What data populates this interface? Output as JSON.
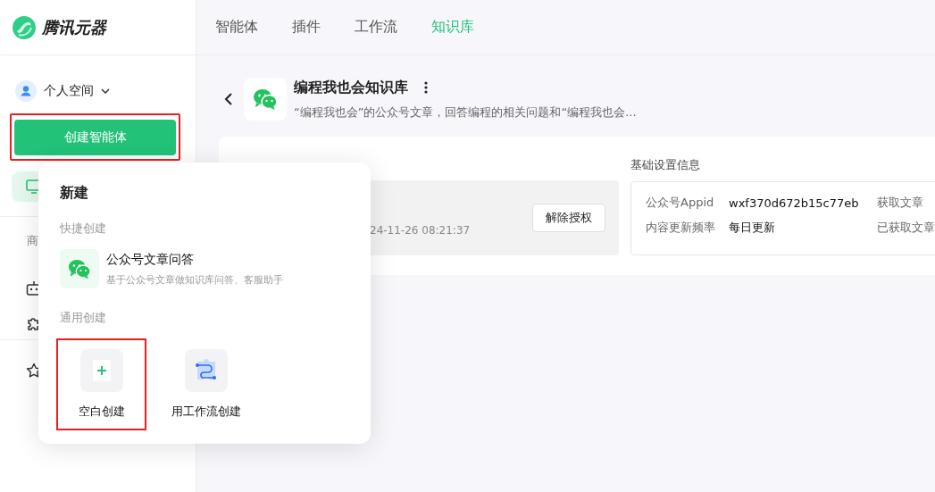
{
  "sidebar": {
    "logo": "腾讯元器",
    "space": "个人空间",
    "create_button": {
      "label": "创建智能体",
      "highlighted": true
    },
    "nav": [
      {
        "kind": "item",
        "selected": true
      },
      {
        "kind": "section",
        "label": "商"
      },
      {
        "kind": "item",
        "selected": false
      },
      {
        "kind": "item",
        "selected": false
      },
      {
        "kind": "divider"
      },
      {
        "kind": "item",
        "selected": false
      }
    ]
  },
  "tabs": [
    {
      "label": "智能体",
      "selected": false
    },
    {
      "label": "插件",
      "selected": false
    },
    {
      "label": "工作流",
      "selected": false
    },
    {
      "label": "知识库",
      "selected": true
    }
  ],
  "knowledge_base": {
    "title": "编程我也会知识库",
    "description": "“编程我也会”的公众号文章，回答编程的相关问题和“编程我也会..."
  },
  "authorized": {
    "date": "24-11-26 08:21:37",
    "button": "解除授权"
  },
  "settings": {
    "heading": "基础设置信息",
    "rows": [
      {
        "label": "公众号Appid",
        "value": "wxf370d672b15c77eb",
        "column_3": "获取文章"
      },
      {
        "label": "内容更新频率",
        "value": "每日更新",
        "column_3": "已获取文章"
      }
    ]
  },
  "popup": {
    "title": "新建",
    "sections": [
      {
        "heading": "快捷创建",
        "items": [
          {
            "kind": "quick",
            "title": "公众号文章问答",
            "description": "基于公众号文章做知识库问答、客服助手"
          }
        ]
      },
      {
        "heading": "通用创建",
        "items": [
          {
            "kind": "tile",
            "label": "空白创建",
            "highlighted": true
          },
          {
            "kind": "tile",
            "label": "用工作流创建",
            "highlighted": false
          }
        ]
      }
    ]
  }
}
